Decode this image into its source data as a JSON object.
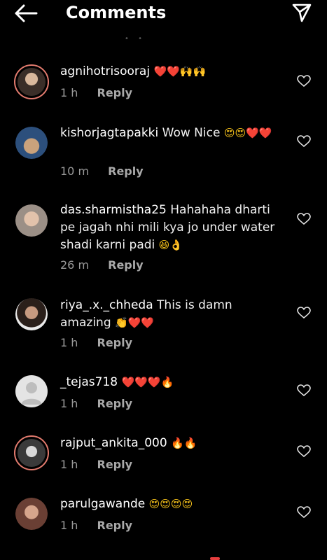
{
  "header": {
    "title": "Comments"
  },
  "comments": [
    {
      "username": "agnihotrisooraj",
      "text": "",
      "emojis": "❤️❤️🙌🙌",
      "time": "1 h",
      "reply": "Reply",
      "avatar_color": "#6f5a4c",
      "story_ring": true
    },
    {
      "username": "kishorjagtapakki",
      "text": "Wow Nice",
      "emojis": "😍😍❤️❤️",
      "time": "10 m",
      "reply": "Reply",
      "avatar_color": "#4a8fc9",
      "story_ring": false
    },
    {
      "username": "das.sharmistha25",
      "text": "Hahahaha dharti pe jagah nhi mili kya jo under water shadi karni padi",
      "emojis": "😆👌",
      "time": "26 m",
      "reply": "Reply",
      "avatar_color": "#c9a894",
      "story_ring": false
    },
    {
      "username": "riya_.x._chheda",
      "text": "This is damn amazing",
      "emojis": "👏❤️❤️",
      "time": "1 h",
      "reply": "Reply",
      "avatar_color": "#8a6a5a",
      "story_ring": false
    },
    {
      "username": "_tejas718",
      "text": "",
      "emojis": "❤️❤️❤️🔥",
      "time": "1 h",
      "reply": "Reply",
      "avatar_color": "#dbdbdb",
      "story_ring": false
    },
    {
      "username": "rajput_ankita_000",
      "text": "",
      "emojis": "🔥🔥",
      "time": "1 h",
      "reply": "Reply",
      "avatar_color": "#7a7a7a",
      "story_ring": true
    },
    {
      "username": "parulgawande",
      "text": "",
      "emojis": "😍😍😍😍",
      "time": "1 h",
      "reply": "Reply",
      "avatar_color": "#b58a76",
      "story_ring": false
    }
  ]
}
